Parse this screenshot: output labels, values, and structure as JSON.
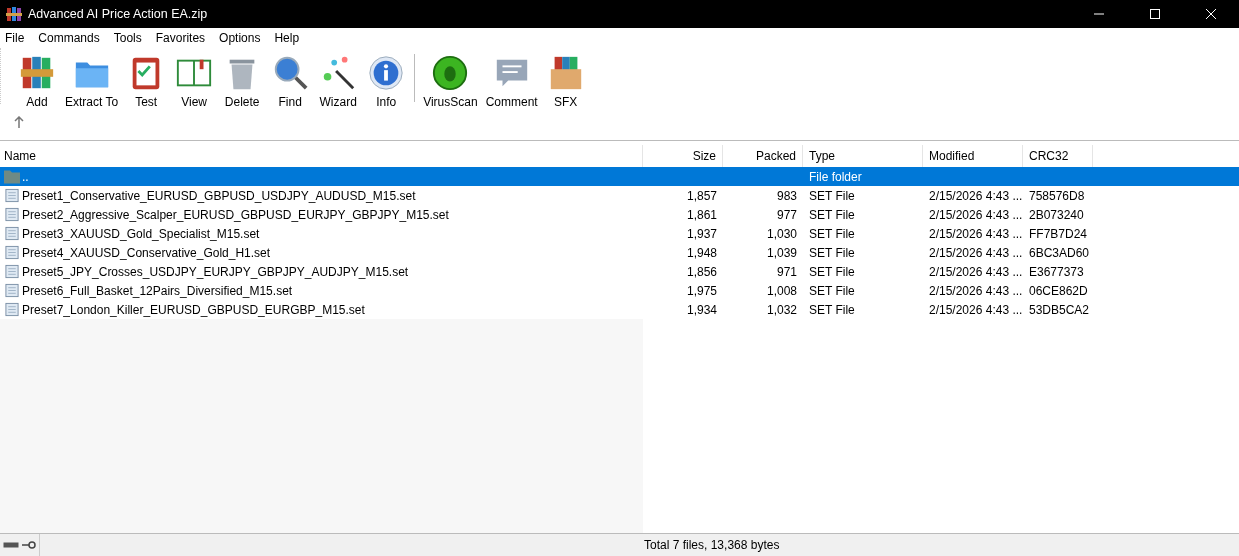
{
  "window": {
    "title": "Advanced AI Price Action EA.zip"
  },
  "menu": [
    "File",
    "Commands",
    "Tools",
    "Favorites",
    "Options",
    "Help"
  ],
  "toolbar": [
    {
      "label": "Add"
    },
    {
      "label": "Extract To"
    },
    {
      "label": "Test"
    },
    {
      "label": "View"
    },
    {
      "label": "Delete"
    },
    {
      "label": "Find"
    },
    {
      "label": "Wizard"
    },
    {
      "label": "Info"
    },
    {
      "label": "VirusScan"
    },
    {
      "label": "Comment"
    },
    {
      "label": "SFX"
    }
  ],
  "table": {
    "columns": [
      "Name",
      "Size",
      "Packed",
      "Type",
      "Modified",
      "CRC32"
    ],
    "rows": [
      {
        "kind": "folder",
        "selected": true,
        "name": "..",
        "size": "",
        "packed": "",
        "type": "File folder",
        "modified": "",
        "crc": ""
      },
      {
        "kind": "file",
        "selected": false,
        "name": "Preset1_Conservative_EURUSD_GBPUSD_USDJPY_AUDUSD_M15.set",
        "size": "1,857",
        "packed": "983",
        "type": "SET File",
        "modified": "2/15/2026 4:43 ...",
        "crc": "758576D8"
      },
      {
        "kind": "file",
        "selected": false,
        "name": "Preset2_Aggressive_Scalper_EURUSD_GBPUSD_EURJPY_GBPJPY_M15.set",
        "size": "1,861",
        "packed": "977",
        "type": "SET File",
        "modified": "2/15/2026 4:43 ...",
        "crc": "2B073240"
      },
      {
        "kind": "file",
        "selected": false,
        "name": "Preset3_XAUUSD_Gold_Specialist_M15.set",
        "size": "1,937",
        "packed": "1,030",
        "type": "SET File",
        "modified": "2/15/2026 4:43 ...",
        "crc": "FF7B7D24"
      },
      {
        "kind": "file",
        "selected": false,
        "name": "Preset4_XAUUSD_Conservative_Gold_H1.set",
        "size": "1,948",
        "packed": "1,039",
        "type": "SET File",
        "modified": "2/15/2026 4:43 ...",
        "crc": "6BC3AD60"
      },
      {
        "kind": "file",
        "selected": false,
        "name": "Preset5_JPY_Crosses_USDJPY_EURJPY_GBPJPY_AUDJPY_M15.set",
        "size": "1,856",
        "packed": "971",
        "type": "SET File",
        "modified": "2/15/2026 4:43 ...",
        "crc": "E3677373"
      },
      {
        "kind": "file",
        "selected": false,
        "name": "Preset6_Full_Basket_12Pairs_Diversified_M15.set",
        "size": "1,975",
        "packed": "1,008",
        "type": "SET File",
        "modified": "2/15/2026 4:43 ...",
        "crc": "06CE862D"
      },
      {
        "kind": "file",
        "selected": false,
        "name": "Preset7_London_Killer_EURUSD_GBPUSD_EURGBP_M15.set",
        "size": "1,934",
        "packed": "1,032",
        "type": "SET File",
        "modified": "2/15/2026 4:43 ...",
        "crc": "53DB5CA2"
      }
    ]
  },
  "status_bar": {
    "text": "Total 7 files, 13,368 bytes"
  }
}
